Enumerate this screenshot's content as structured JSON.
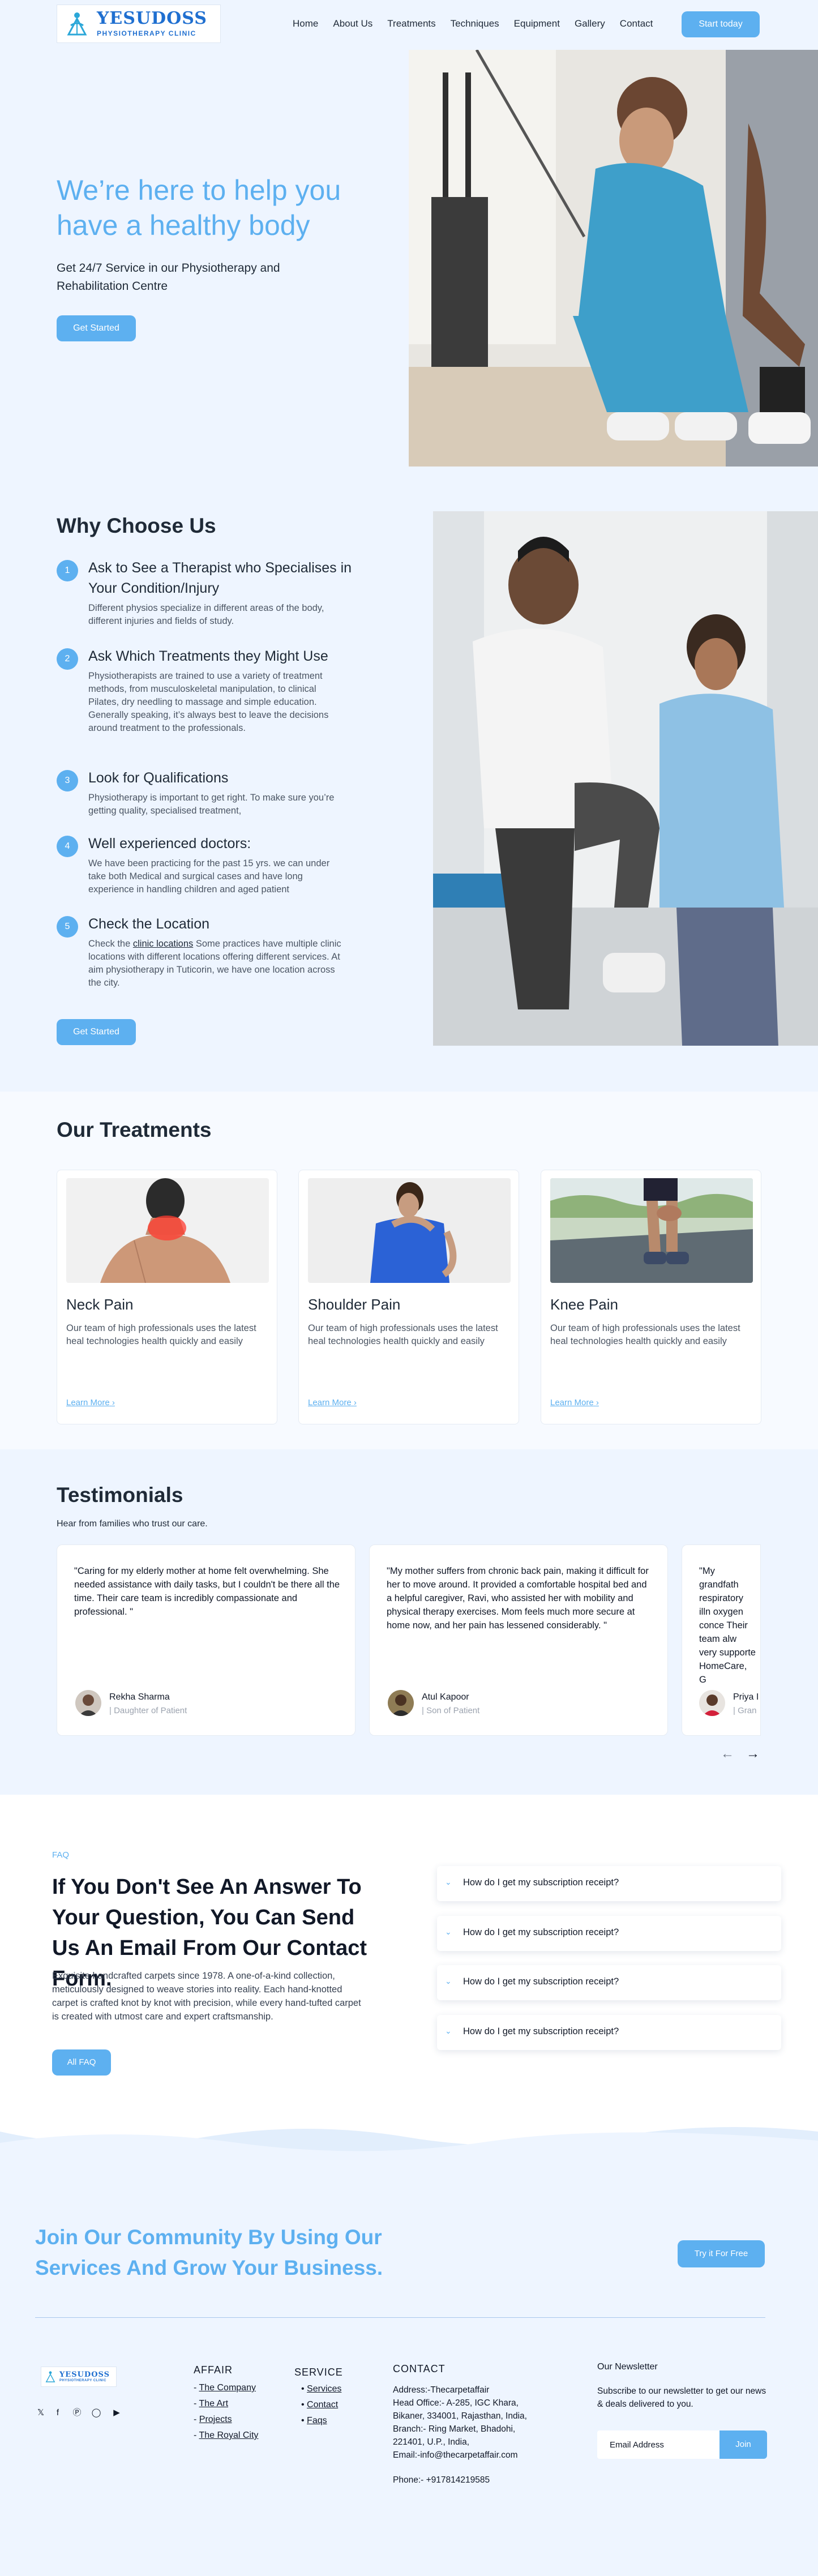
{
  "brand": {
    "name": "YESUDOSS",
    "tagline": "PHYSIOTHERAPY CLINIC",
    "accent": "#5db0f0",
    "background": "#eef5ff"
  },
  "nav": {
    "links": [
      "Home",
      "About Us",
      "Treatments",
      "Techniques",
      "Equipment",
      "Gallery",
      "Contact"
    ],
    "cta": "Start today"
  },
  "hero": {
    "title": "We’re here to help you have a healthy body",
    "subtitle": "Get 24/7 Service in our Physiotherapy and Rehabilitation Centre",
    "cta": "Get Started"
  },
  "why": {
    "title": "Why Choose Us",
    "items": [
      {
        "num": "1",
        "title": "Ask to See a Therapist who Specialises in Your Condition/Injury",
        "text": "Different physios specialize in different areas of the body, different injuries and fields of study."
      },
      {
        "num": "2",
        "title": "Ask Which Treatments they Might Use",
        "text": "Physiotherapists are trained to use a variety of treatment methods, from musculoskeletal manipulation, to clinical Pilates, dry needling to massage and simple education. Generally speaking, it’s always best to leave the decisions around treatment to the professionals."
      },
      {
        "num": "3",
        "title": "Look for Qualifications",
        "text": "Physiotherapy is important to get right. To make sure you’re getting quality, specialised treatment,"
      },
      {
        "num": "4",
        "title": "Well experienced doctors:",
        "text": "We have been practicing for the past 15 yrs. we can under take both Medical and surgical cases and have long experience in handling children and aged patient"
      },
      {
        "num": "5",
        "title": "Check the Location",
        "text_before": "Check the ",
        "link": "clinic locations",
        "text_after": " Some practices have multiple clinic locations with different locations offering different services. At aim physiotherapy in Tuticorin, we have one location across the city."
      }
    ],
    "cta": "Get Started"
  },
  "treatments": {
    "title": "Our Treatments",
    "cards": [
      {
        "title": "Neck Pain",
        "text": "Our team of high professionals uses the latest heal technologies health quickly and easily",
        "link": "Learn More"
      },
      {
        "title": "Shoulder Pain",
        "text": "Our team of high professionals uses the latest heal technologies health quickly and easily",
        "link": "Learn More"
      },
      {
        "title": "Knee Pain",
        "text": "Our team of high professionals uses the latest heal technologies health quickly and easily",
        "link": "Learn More"
      }
    ]
  },
  "testimonials": {
    "title": "Testimonials",
    "subtitle": "Hear from families who trust our care.",
    "items": [
      {
        "quote": "\"Caring for my elderly mother at home felt overwhelming. She needed assistance with daily tasks, but I couldn't be there all the time.  Their care team is incredibly compassionate and professional. \"",
        "name": "Rekha Sharma",
        "role": "| Daughter of Patient"
      },
      {
        "quote": "\"My mother suffers from chronic back pain, making it difficult for her to move around. It provided a comfortable hospital bed and a helpful caregiver, Ravi, who assisted her with mobility and physical therapy exercises. Mom feels much more secure at home now, and her pain has lessened considerably. \"",
        "name": "Atul Kapoor",
        "role": "| Son of Patient"
      },
      {
        "quote": "\"My grandfath respiratory illn oxygen conce Their team alw very supporte HomeCare, G",
        "name": "Priya I",
        "role": "| Gran"
      }
    ],
    "prev": "←",
    "next": "→"
  },
  "faq": {
    "tag": "FAQ",
    "title": "If You Don't See An Answer To Your Question, You Can Send Us An Email From Our Contact Form.",
    "text": "Exquisite handcrafted carpets since 1978. A one-of-a-kind collection, meticulously designed to weave stories into reality. Each hand-knotted carpet is crafted knot by knot with precision, while every hand-tufted carpet is created with utmost care and expert craftsmanship.",
    "cta": "All FAQ",
    "questions": [
      "How do I get my subscription receipt?",
      "How do I get my subscription receipt?",
      "How do I get my subscription receipt?",
      "How do I get my subscription receipt?"
    ]
  },
  "join": {
    "title": "Join Our Community By Using Our Services And Grow Your Business.",
    "cta": "Try it For Free"
  },
  "footer": {
    "affair": {
      "title": "AFFAIR",
      "links": [
        "The Company",
        "The Art",
        "Projects",
        "The Royal City"
      ]
    },
    "service": {
      "title": "SERVICE",
      "links": [
        "Services",
        "Contact",
        "Faqs"
      ]
    },
    "contact": {
      "title": "CONTACT",
      "lines": [
        "Address:-Thecarpetaffair",
        "Head Office:- A-285, IGC Khara,",
        "Bikaner, 334001, Rajasthan, India,",
        "Branch:- Ring Market, Bhadohi,",
        "221401, U.P., India,",
        "Email:-info@thecarpetaffair.com"
      ],
      "phone": "Phone:- +917814219585"
    },
    "newsletter": {
      "title": "Our Newsletter",
      "text": "Subscribe to our newsletter to get our news & deals delivered to you.",
      "placeholder": "Email Address",
      "button": "Join"
    },
    "social_icons": [
      "twitter-icon",
      "facebook-icon",
      "pinterest-icon",
      "instagram-icon",
      "youtube-icon"
    ]
  }
}
